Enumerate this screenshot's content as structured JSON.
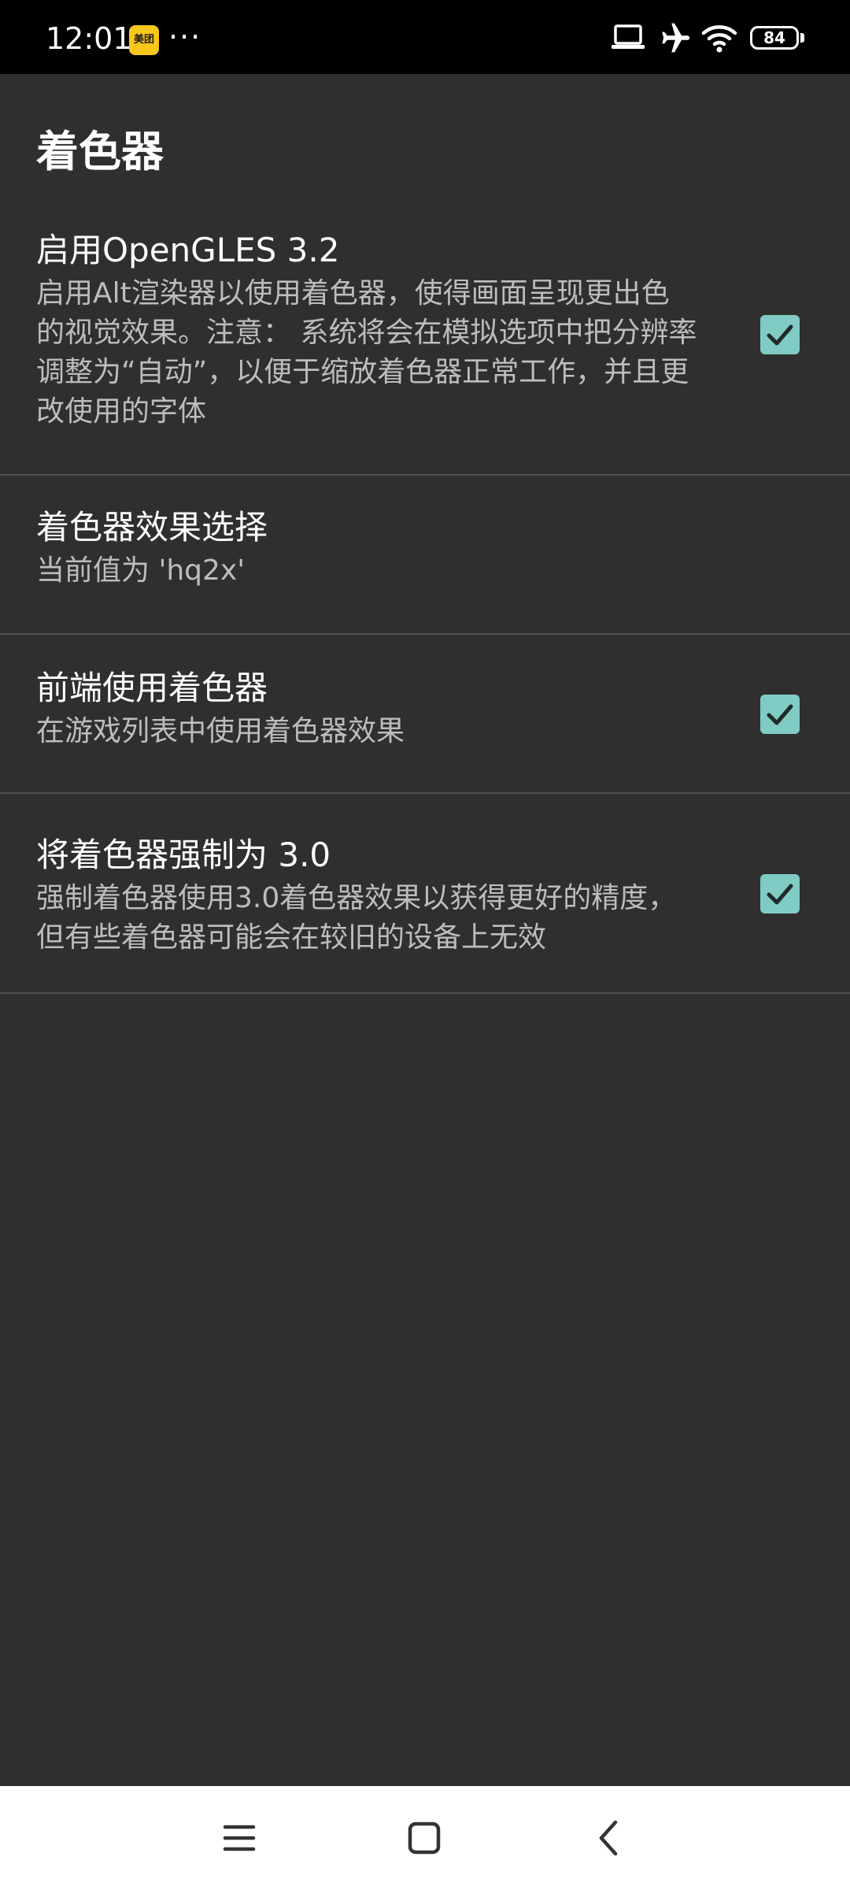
{
  "status_bar": {
    "time": "12:01",
    "app_badge": "美团",
    "more": "···",
    "battery": "84"
  },
  "page": {
    "title": "着色器"
  },
  "settings": [
    {
      "title": "启用OpenGLES 3.2",
      "summary": "启用Alt渲染器以使用着色器，使得画面呈现更出色的视觉效果。注意： 系统将会在模拟选项中把分辨率调整为“自动”，以便于缩放着色器正常工作，并且更改使用的字体",
      "checked": true
    },
    {
      "title": "着色器效果选择",
      "summary": "当前值为 'hq2x'"
    },
    {
      "title": "前端使用着色器",
      "summary": "在游戏列表中使用着色器效果",
      "checked": true
    },
    {
      "title": "将着色器强制为 3.0",
      "summary": "强制着色器使用3.0着色器效果以获得更好的精度，但有些着色器可能会在较旧的设备上无效",
      "checked": true
    }
  ],
  "colors": {
    "background": "#2f2f2f",
    "checkbox": "#80cbc4",
    "divider": "#4e4e4e",
    "summary_text": "#bdbdbd"
  },
  "icons": {
    "status": [
      "laptop-icon",
      "airplane-icon",
      "wifi-icon",
      "battery-icon"
    ],
    "nav": [
      "menu-icon",
      "home-icon",
      "back-icon"
    ]
  }
}
